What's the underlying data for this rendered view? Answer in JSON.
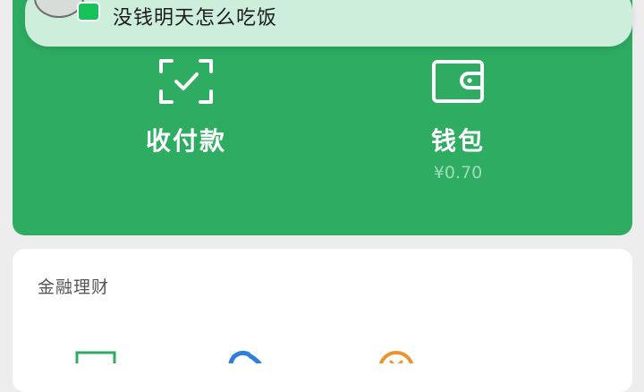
{
  "notification": {
    "message": "没钱明天怎么吃饭",
    "avatar_icon": "user-avatar-icon",
    "badge_icon": "wechat-message-icon"
  },
  "features": [
    {
      "label": "收付款",
      "icon": "scan-check-icon"
    },
    {
      "label": "钱包",
      "sub": "¥0.70",
      "icon": "wallet-icon"
    }
  ],
  "finance": {
    "title": "金融理财",
    "icons": [
      "green-square-icon",
      "blue-swirl-icon",
      "orange-coin-icon"
    ]
  },
  "colors": {
    "card_green": "#2eac62",
    "notification_bg": "#cdeedb",
    "page_bg": "#ededed"
  }
}
